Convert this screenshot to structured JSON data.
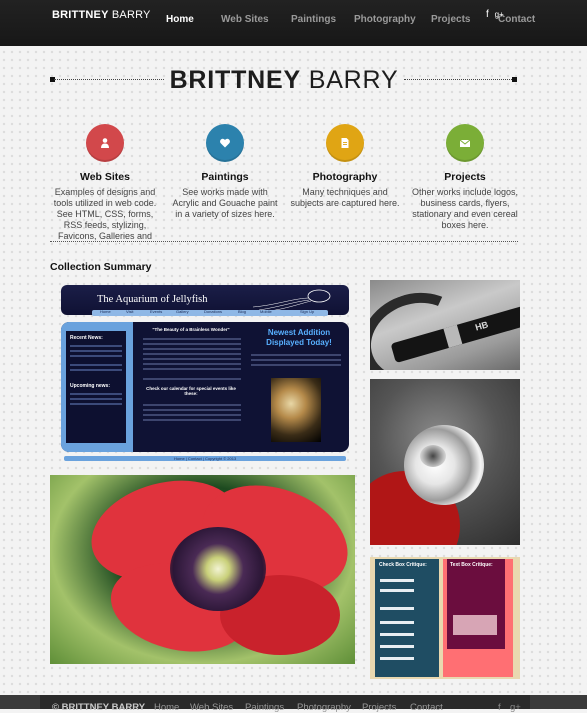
{
  "header": {
    "brand_first": "BRITTNEY",
    "brand_last": "BARRY",
    "nav": [
      "Home",
      "Web Sites",
      "Paintings",
      "Photography",
      "Projects",
      "Contact"
    ],
    "active_nav": "Home",
    "social": [
      "f",
      "g+"
    ]
  },
  "title": {
    "first": "BRITTNEY",
    "last": "BARRY"
  },
  "features": [
    {
      "title": "Web Sites",
      "icon": "user-icon",
      "color": "#d2484b",
      "desc": "Examples of designs and tools utilized in web code. See HTML, CSS, forms, RSS feeds, stylizing, Favicons, Galleries and much more here."
    },
    {
      "title": "Paintings",
      "icon": "heart-icon",
      "color": "#2c82ad",
      "desc": "See works made with Acrylic and Gouache paint in a variety of sizes here."
    },
    {
      "title": "Photography",
      "icon": "document-icon",
      "color": "#e0a514",
      "desc": "Many techniques and subjects are captured here."
    },
    {
      "title": "Projects",
      "icon": "envelope-icon",
      "color": "#7bae37",
      "desc": "Other works include logos, business cards, flyers, stationary and even cereal boxes here."
    }
  ],
  "collection_heading": "Collection Summary",
  "gallery": {
    "jellyfish": {
      "title": "The Aquarium of Jellyfish",
      "nav": [
        "Home",
        "Visit",
        "Events",
        "Gallery",
        "Donations",
        "Blog",
        "Mobile",
        "Sign Up"
      ],
      "side_heading_1": "Recent News:",
      "side_heading_2": "Upcoming news:",
      "mid_heading": "\"The Beauty of a Brainless Wonder\"",
      "mid_heading_2": "Check our calendar for special events like these:",
      "new_addition": "Newest Addition Displayed Today!",
      "footer": "Home | Contact | Copyright © 2013"
    },
    "pen_label": "HB",
    "critique_left": "Check Box Critique:",
    "critique_right": "Text Box Critique:"
  },
  "footer": {
    "copyright": "© BRITTNEY BARRY",
    "nav": [
      "Home",
      "Web Sites",
      "Paintings",
      "Photography",
      "Projects",
      "Contact"
    ],
    "social": [
      "f",
      "g+"
    ]
  }
}
